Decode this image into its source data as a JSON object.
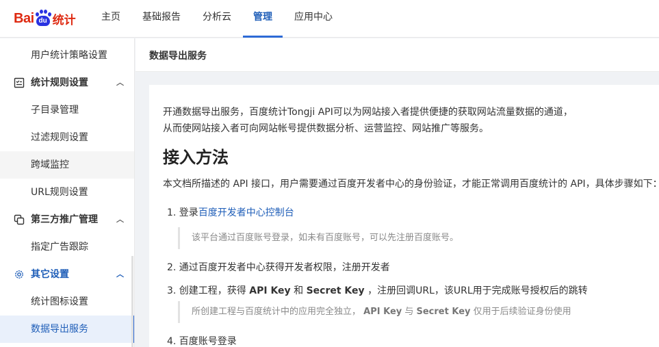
{
  "logo": {
    "bai": "Bai",
    "du": "du",
    "tongji": "统计"
  },
  "nav": [
    {
      "label": "主页"
    },
    {
      "label": "基础报告"
    },
    {
      "label": "分析云"
    },
    {
      "label": "管理",
      "active": true
    },
    {
      "label": "应用中心"
    }
  ],
  "sidebar": {
    "items": [
      {
        "label": "用户统计策略设置"
      },
      {
        "label": "统计规则设置",
        "group": true,
        "icon": "checklist-icon"
      },
      {
        "label": "子目录管理"
      },
      {
        "label": "过滤规则设置"
      },
      {
        "label": "跨域监控"
      },
      {
        "label": "URL规则设置"
      },
      {
        "label": "第三方推广管理",
        "group": true,
        "icon": "copy-icon"
      },
      {
        "label": "指定广告跟踪"
      },
      {
        "label": "其它设置",
        "group": true,
        "icon": "gear-icon"
      },
      {
        "label": "统计图标设置"
      },
      {
        "label": "数据导出服务",
        "selected": true
      }
    ]
  },
  "page": {
    "title": "数据导出服务"
  },
  "content": {
    "intro_line1": "开通数据导出服务，百度统计Tongji API可以为网站接入者提供便捷的获取网站流量数据的通道，",
    "intro_line2": "从而使网站接入者可向网站帐号提供数据分析、运营监控、网站推广等服务。",
    "heading": "接入方法",
    "description": "本文档所描述的 API 接口，用户需要通过百度开发者中心的身份验证，才能正常调用百度统计的 API，具体步骤如下：",
    "step1_prefix": "1. 登录",
    "step1_link": "百度开发者中心控制台",
    "step1_note": "该平台通过百度账号登录，如未有百度账号，可以先注册百度账号。",
    "step2": "2. 通过百度开发者中心获得开发者权限，注册开发者",
    "step3_a": "3. 创建工程，获得 ",
    "step3_key1": "API Key",
    "step3_b": " 和 ",
    "step3_key2": "Secret Key",
    "step3_c": " ，注册回调URL，该URL用于完成账号授权后的跳转",
    "step3_note_a": "所创建工程与百度统计中的应用完全独立， ",
    "step3_note_key1": "API Key",
    "step3_note_b": " 与 ",
    "step3_note_key2": "Secret Key",
    "step3_note_c": " 仅用于后续验证身份使用",
    "step4": "4. 百度账号登录"
  },
  "colors": {
    "brand_red": "#de2910",
    "brand_blue": "#2932e1",
    "accent": "#2d6ad6",
    "link": "#1f5eb8"
  }
}
